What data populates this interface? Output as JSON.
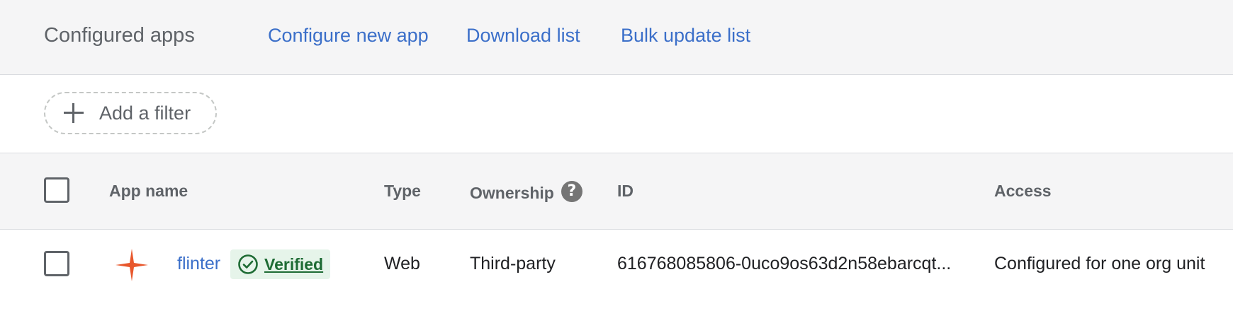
{
  "header": {
    "title": "Configured apps",
    "links": {
      "configure_new_app": "Configure new app",
      "download_list": "Download list",
      "bulk_update_list": "Bulk update list"
    }
  },
  "filter": {
    "label": "Add a filter",
    "icon": "plus-icon"
  },
  "table": {
    "columns": {
      "app_name": "App name",
      "type": "Type",
      "ownership": "Ownership",
      "id": "ID",
      "access": "Access"
    },
    "ownership_help_icon": "help-icon",
    "ownership_help_glyph": "?",
    "rows": [
      {
        "app_icon": "four-point-star-logo",
        "app_name": "flinter",
        "badge": "Verified",
        "badge_icon": "check-circle-icon",
        "type": "Web",
        "ownership": "Third-party",
        "id": "616768085806-0uco9os63d2n58ebarcqt...",
        "access": "Configured for one org unit"
      }
    ]
  },
  "colors": {
    "link": "#3b6fc9",
    "header_bg": "#f5f5f6",
    "verified_bg": "#e6f4ea",
    "verified_text": "#1e6b34",
    "logo": "#e8572c"
  }
}
